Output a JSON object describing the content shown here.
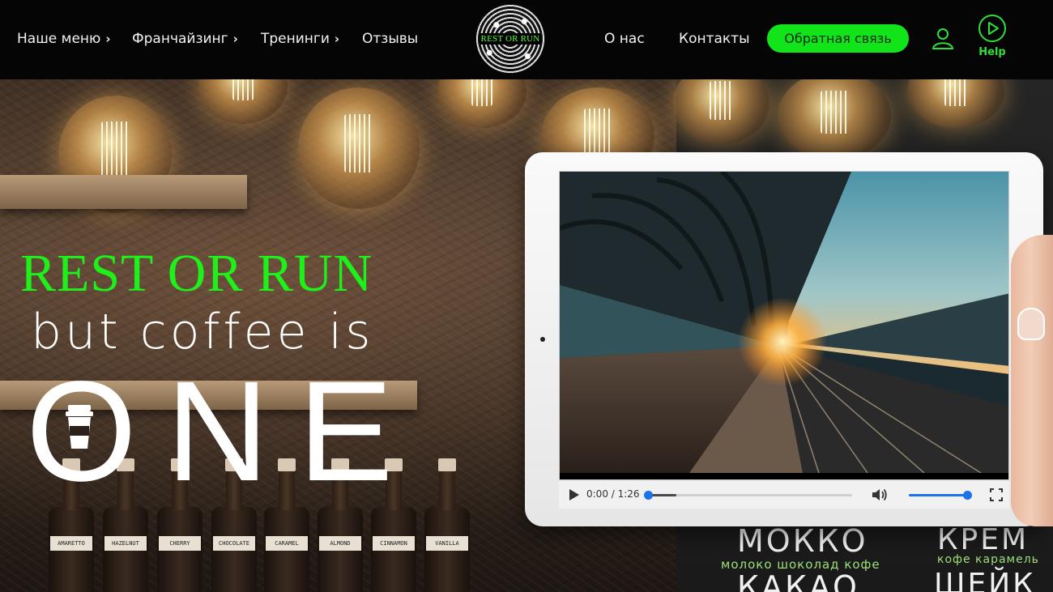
{
  "header": {
    "nav_left": [
      {
        "label": "Наше меню",
        "has_dropdown": true
      },
      {
        "label": "Франчайзинг",
        "has_dropdown": true
      },
      {
        "label": "Тренинги",
        "has_dropdown": true
      },
      {
        "label": "Отзывы",
        "has_dropdown": false
      }
    ],
    "logo_text": "REST OR RUN",
    "nav_right": [
      {
        "label": "О нас"
      },
      {
        "label": "Контакты"
      }
    ],
    "cta_label": "Обратная связь",
    "user_icon": "user-icon",
    "help_label": "Help",
    "help_icon": "play-circle-icon",
    "accent_color": "#12e41a"
  },
  "hero": {
    "brand": "REST OR RUN",
    "tagline": "but coffee is",
    "big_word": "ONE",
    "cup_icon": "coffee-cup-icon",
    "bottle_labels": [
      "AMARETTO",
      "HAZELNUT",
      "CHERRY",
      "CHOCOLATE",
      "CARAMEL",
      "ALMOND",
      "CINNAMON",
      "VANILLA"
    ],
    "board_items": [
      {
        "title": "МОККО",
        "subtitle": "молоко шоколад кофе"
      },
      {
        "title": "КРЕМ",
        "subtitle": "кофе карамель"
      },
      {
        "title": "КАКАО",
        "subtitle": ""
      },
      {
        "title": "ШЕЙК",
        "subtitle": ""
      }
    ]
  },
  "video": {
    "current_time": "0:00",
    "duration": "1:26",
    "time_display": "0:00 / 1:26",
    "progress_fraction": 0.0,
    "buffered_fraction": 0.14,
    "volume_fraction": 1.0,
    "play_icon": "play-icon",
    "volume_icon": "volume-icon",
    "fullscreen_icon": "fullscreen-icon"
  }
}
